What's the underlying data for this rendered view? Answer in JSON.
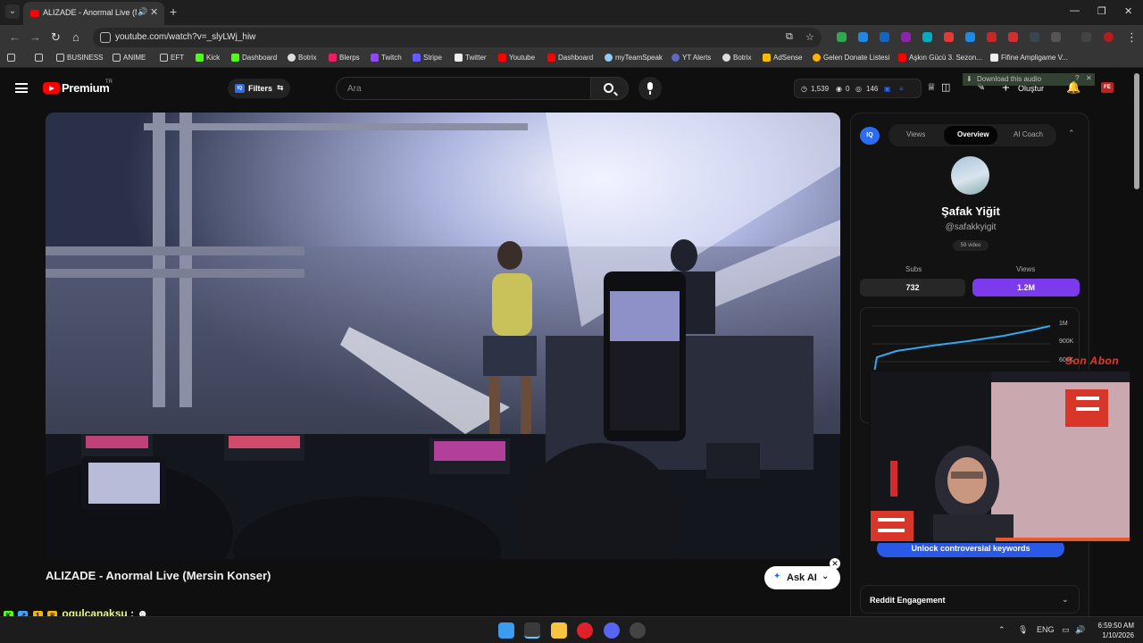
{
  "browser": {
    "tab_title": "ALIZADE - Anormal Live (M",
    "url": "youtube.com/watch?v=_slyLWj_hiw"
  },
  "bookmarks": [
    "BUSINESS",
    "ANIME",
    "EFT",
    "Kick",
    "Dashboard",
    "Botrix",
    "Blerps",
    "Twitch",
    "Stripe",
    "Twitter",
    "Youtube",
    "Dashboard",
    "myTeamSpeak",
    "YT Alerts",
    "Botrix",
    "AdSense",
    "Gelen Donate Listesi",
    "Aşkın Gücü 3. Sezon...",
    "Fifine Ampligame V..."
  ],
  "youtube": {
    "brand": "Premium",
    "country": "TR",
    "filters_label": "Filters",
    "search_placeholder": "Ara",
    "stats": {
      "views": "1,539",
      "zero": "0",
      "eye": "146"
    },
    "create_label": "Oluştur",
    "download_popup": "Download this audio"
  },
  "video": {
    "title": "ALIZADE - Anormal Live (Mersin Konser)",
    "ask_ai": "Ask AI"
  },
  "panel": {
    "logo": "IQ",
    "tabs": [
      "Views",
      "Overview",
      "AI Coach"
    ],
    "channel_name": "Şafak Yiğit",
    "channel_handle": "@safakkyigit",
    "video_count": "59 video",
    "subs_label": "Subs",
    "views_label": "Views",
    "subs_value": "732",
    "views_value": "1.2M",
    "chart_labels": [
      "1M",
      "900K",
      "600K"
    ],
    "unlock_label": "Unlock controversial keywords",
    "reddit_label": "Reddit Engagement"
  },
  "overlay": {
    "abon_text": "Son Abon"
  },
  "chat": {
    "user": "ogulcanaksu",
    "sep": ":"
  },
  "taskbar": {
    "lang": "ENG",
    "time": "6:59:50 AM",
    "date": "1/10/2026"
  }
}
